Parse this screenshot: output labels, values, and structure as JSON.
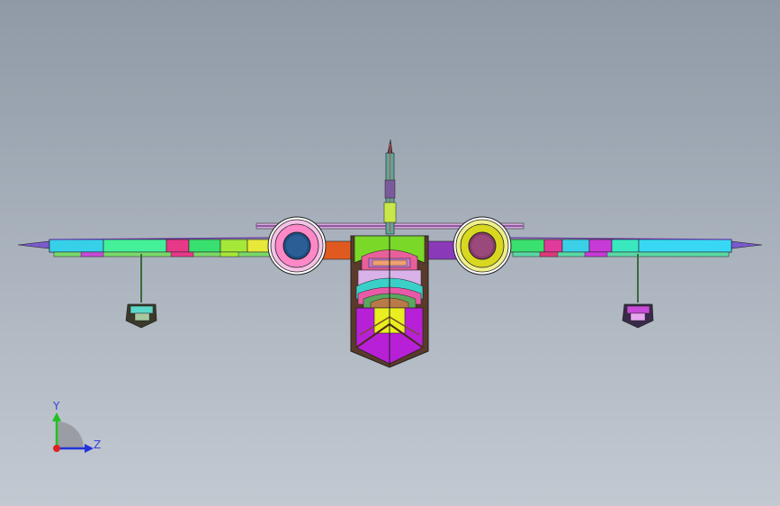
{
  "viewport": {
    "background_top": "#8f9aa6",
    "background_bottom": "#c3c9d1"
  },
  "triad": {
    "y_label": "Y",
    "z_label": "Z",
    "y_color": "#22c022",
    "z_color": "#2233dd",
    "x_color": "#dd2222"
  },
  "model": {
    "icon": "seaplane-front-view",
    "colors": {
      "wing_cyan": "#33e6c8",
      "wing_magenta": "#d63ad6",
      "engine_left_ring": "#ff88c8",
      "engine_left_hub": "#1e4e84",
      "engine_right_ring": "#d8d820",
      "engine_right_hub": "#8a3a6a",
      "hull_yellow": "#e8ee20",
      "hull_purple": "#b820d8",
      "hull_brown": "#7a4a2a",
      "fuselage_green": "#7ad828"
    }
  }
}
